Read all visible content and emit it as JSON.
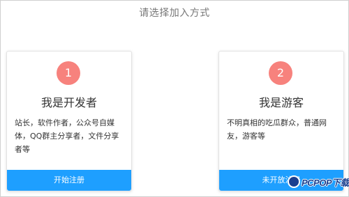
{
  "page": {
    "title": "请选择加入方式"
  },
  "cards": [
    {
      "number": "1",
      "title": "我是开发者",
      "description": "站长，软件作者，公众号自媒体，QQ群主分享者，文件分享者等",
      "button_label": "开始注册"
    },
    {
      "number": "2",
      "title": "我是游客",
      "description": "不明真相的吃瓜群众，普通网友，游客等",
      "button_label": "未开放注册"
    }
  ],
  "watermark": {
    "text": "PCPOP下载"
  },
  "colors": {
    "accent": "#1e9fff",
    "badge": "#f7827d",
    "title_text": "#777777"
  }
}
